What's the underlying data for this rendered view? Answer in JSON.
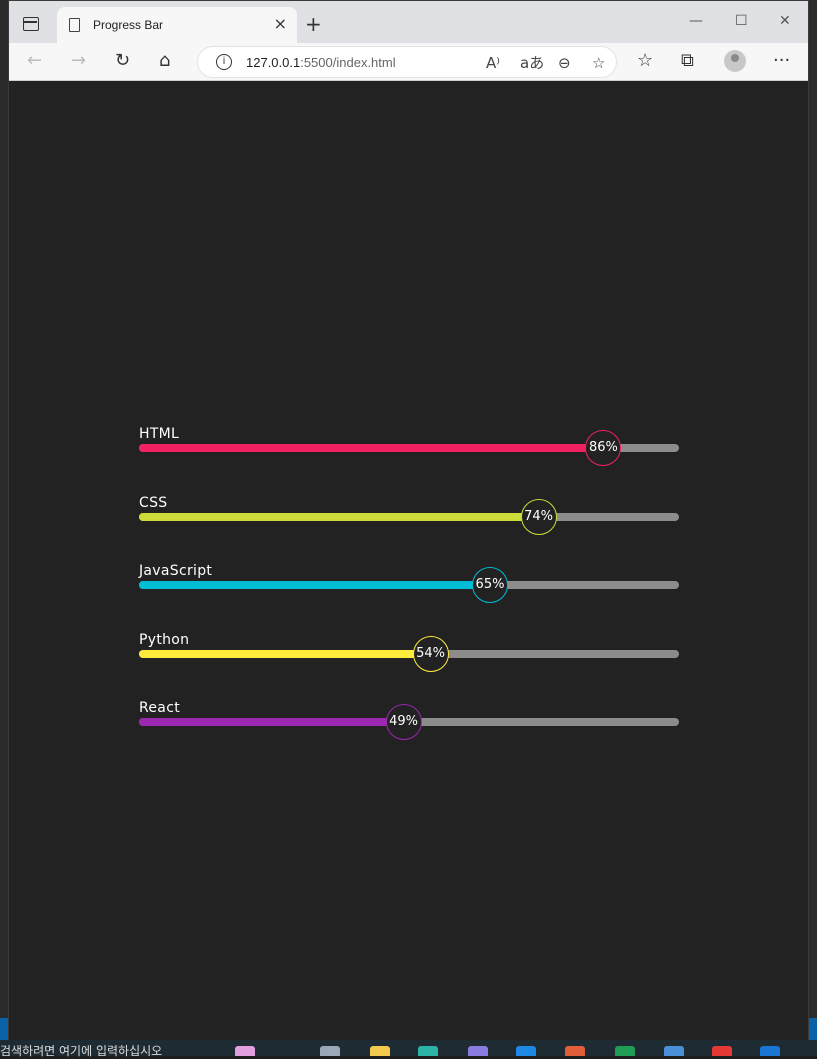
{
  "browser": {
    "tab_title": "Progress Bar",
    "url_host": "127.0.0.1",
    "url_rest": ":5500/index.html"
  },
  "icons": {
    "tab_toggle": "tab-actions-icon",
    "back": "arrow-left-icon",
    "forward": "arrow-right-icon",
    "refresh": "refresh-icon",
    "home": "home-icon",
    "read_aloud": "read-aloud-icon",
    "translate": "translate-icon",
    "zoom_out": "zoom-out-icon",
    "favorite_add": "star-plus-icon",
    "favorites": "favorites-icon",
    "collections": "collections-icon",
    "more": "more-icon"
  },
  "skills": [
    {
      "name": "HTML",
      "percent": 86,
      "percent_label": "86%",
      "color": "#f0215f"
    },
    {
      "name": "CSS",
      "percent": 74,
      "percent_label": "74%",
      "color": "#cddc39"
    },
    {
      "name": "JavaScript",
      "percent": 65,
      "percent_label": "65%",
      "color": "#00bcd4"
    },
    {
      "name": "Python",
      "percent": 54,
      "percent_label": "54%",
      "color": "#ffeb3b"
    },
    {
      "name": "React",
      "percent": 49,
      "percent_label": "49%",
      "color": "#9c27b0"
    }
  ],
  "taskbar": {
    "search_text": "검색하려면 여기에 입력하십시오"
  }
}
